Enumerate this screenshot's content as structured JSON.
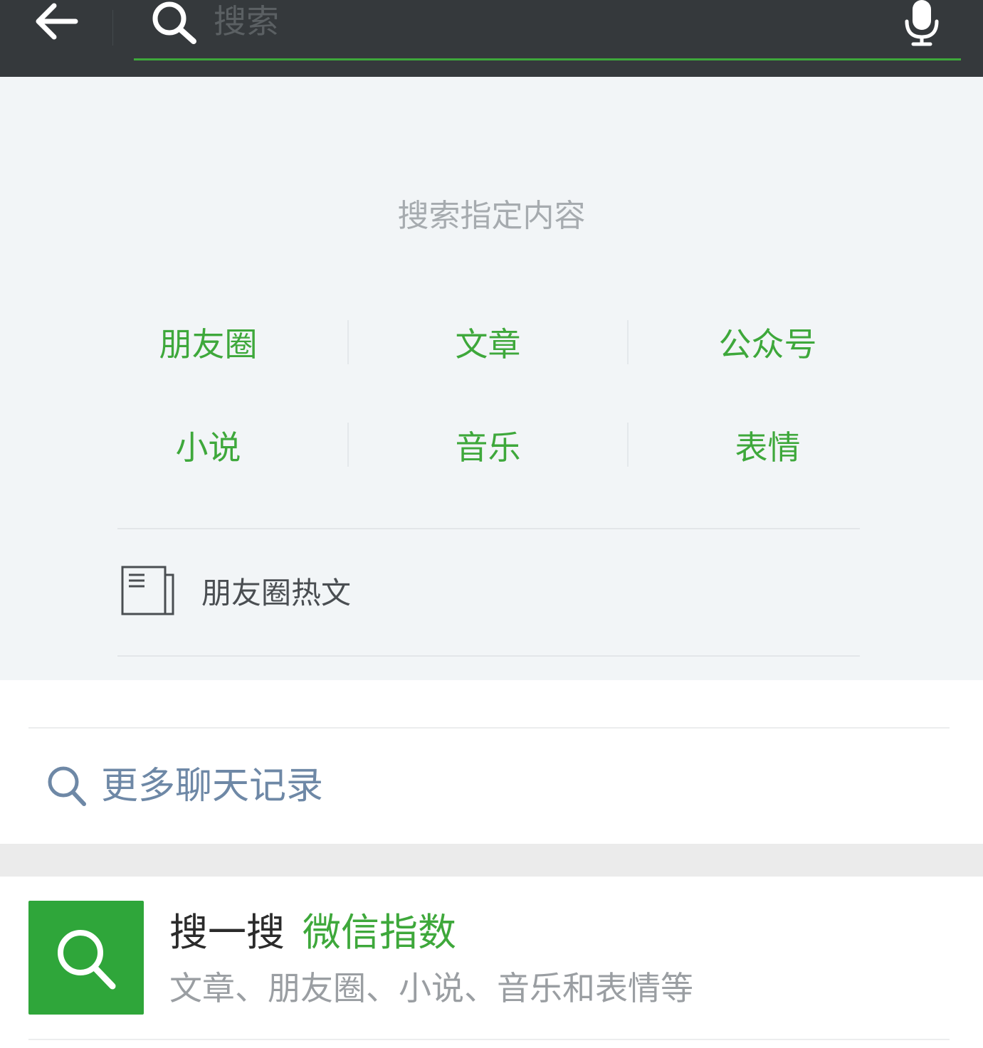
{
  "search": {
    "placeholder": "搜索"
  },
  "icons": {
    "back": "arrow-left-icon",
    "search": "search-icon",
    "mic": "microphone-icon",
    "hot_articles": "newspaper-icon"
  },
  "panel": {
    "heading": "搜索指定内容",
    "categories": [
      {
        "label": "朋友圈"
      },
      {
        "label": "文章"
      },
      {
        "label": "公众号"
      },
      {
        "label": "小说"
      },
      {
        "label": "音乐"
      },
      {
        "label": "表情"
      }
    ],
    "hot_articles_label": "朋友圈热文"
  },
  "more_chat": {
    "label": "更多聊天记录"
  },
  "souyisou": {
    "title": "搜一搜",
    "highlight": "微信指数",
    "subtitle": "文章、朋友圈、小说、音乐和表情等"
  },
  "colors": {
    "topbar": "#35393c",
    "accent": "#3ea83b",
    "panel_bg": "#f2f5f7",
    "link_blue": "#6e88a6",
    "tile_green": "#2fa63a"
  }
}
